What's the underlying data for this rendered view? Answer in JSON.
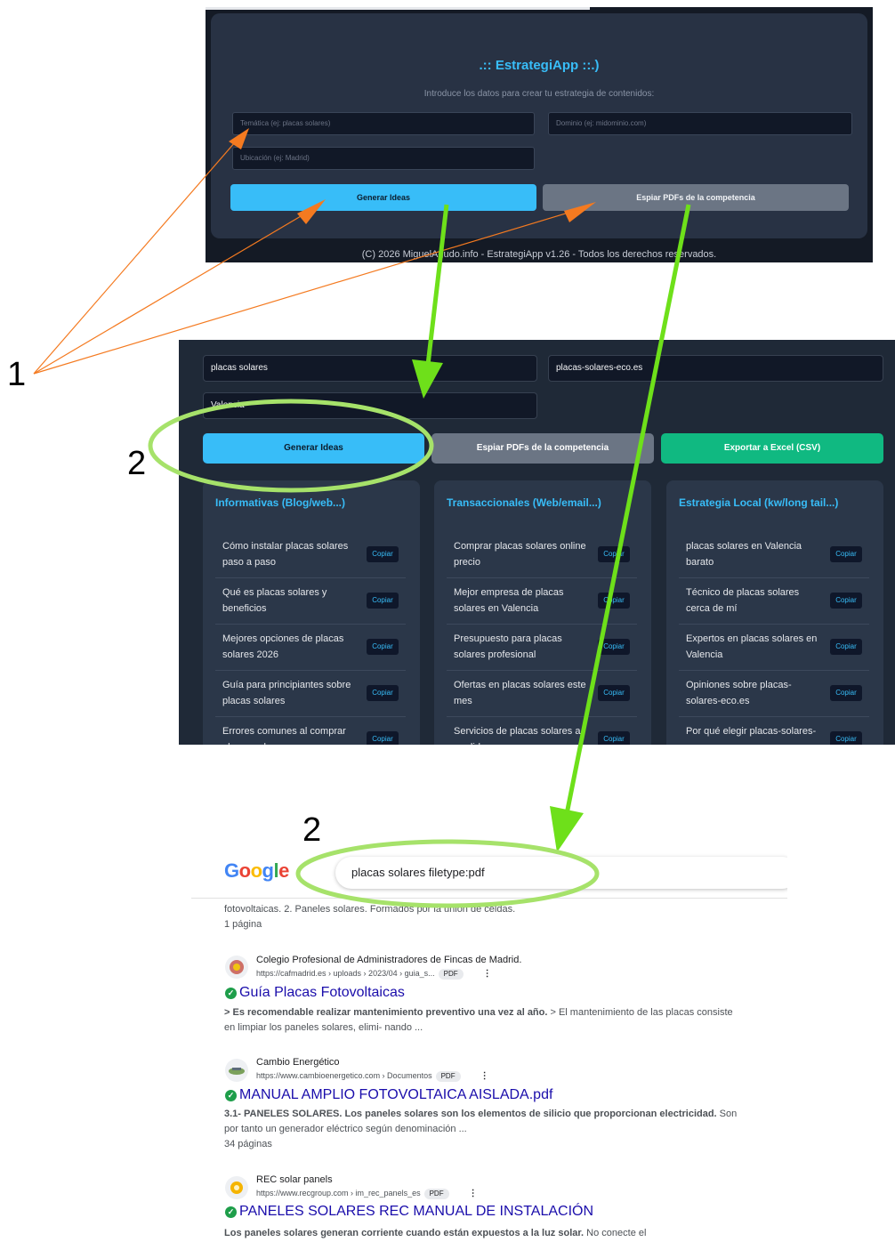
{
  "panel1": {
    "title": ".:: EstrategiApp ::.)",
    "subtitle": "Introduce los datos para crear tu estrategia de contenidos:",
    "tematica_placeholder": "Temática (ej: placas solares)",
    "dominio_placeholder": "Dominio (ej: midominio.com)",
    "ubicacion_placeholder": "Ubicación (ej: Madrid)",
    "generar_label": "Generar Ideas",
    "espiar_label": "Espiar PDFs de la competencia",
    "footer": "(C) 2026 MiguelAgudo.info - EstrategiApp v1.26 - Todos los derechos reservados."
  },
  "panel2": {
    "tematica_value": "placas solares",
    "dominio_value": "placas-solares-eco.es",
    "ubicacion_value": "Valencia",
    "generar_label": "Generar Ideas",
    "espiar_label": "Espiar PDFs de la competencia",
    "exportar_label": "Exportar a Excel (CSV)",
    "copy_label": "Copiar",
    "columns": [
      {
        "title": "Informativas (Blog/web...)",
        "items": [
          "Cómo instalar placas solares paso a paso",
          "Qué es placas solares y beneficios",
          "Mejores opciones de placas solares 2026",
          "Guía para principiantes sobre placas solares",
          "Errores comunes al comprar placas solares"
        ]
      },
      {
        "title": "Transaccionales (Web/email...)",
        "items": [
          "Comprar placas solares online precio",
          "Mejor empresa de placas solares en Valencia",
          "Presupuesto para placas solares profesional",
          "Ofertas en placas solares este mes",
          "Servicios de placas solares a medida"
        ]
      },
      {
        "title": "Estrategia Local (kw/long tail...)",
        "items": [
          "placas solares en Valencia barato",
          "Técnico de placas solares cerca de mí",
          "Expertos en placas solares en Valencia",
          "Opiniones sobre placas-solares-eco.es",
          "Por qué elegir placas-solares-eco.es"
        ]
      }
    ]
  },
  "panel3": {
    "logo_letters": [
      "G",
      "o",
      "o",
      "g",
      "l",
      "e"
    ],
    "query": "placas solares filetype:pdf",
    "prev_snippet": "fotovoltaicas. 2. Paneles solares. Formados por la unión de celdas.",
    "prev_pages": "1 página",
    "pdf_badge": "PDF",
    "results": [
      {
        "site": "Colegio Profesional de Administradores de Fincas de Madrid.",
        "url": "https://cafmadrid.es › uploads › 2023/04 › guia_s...",
        "title": "Guía Placas Fotovoltaicas",
        "snippet_bold": "> Es recomendable realizar mantenimiento preventivo una vez al año.",
        "snippet": " > El mantenimiento de las placas consiste en limpiar los paneles solares, elimi- nando ...",
        "pages": ""
      },
      {
        "site": "Cambio Energético",
        "url": "https://www.cambioenergetico.com › Documentos",
        "title": "MANUAL AMPLIO FOTOVOLTAICA AISLADA.pdf",
        "snippet_bold": "3.1- PANELES SOLARES. Los paneles solares son los elementos de silicio que proporcionan electricidad.",
        "snippet": " Son por tanto un generador eléctrico según denominación ...",
        "pages": "34 páginas"
      },
      {
        "site": "REC solar panels",
        "url": "https://www.recgroup.com › im_rec_panels_es",
        "title": "PANELES SOLARES REC MANUAL DE INSTALACIÓN",
        "snippet_bold": "Los paneles solares generan corriente cuando están expuestos a la luz solar.",
        "snippet": " No conecte el",
        "pages": ""
      }
    ]
  },
  "annotations": {
    "label_1": "1",
    "label_2a": "2",
    "label_2b": "2",
    "arrow_orange": "#f47a20",
    "arrow_green": "#6ee01a"
  }
}
